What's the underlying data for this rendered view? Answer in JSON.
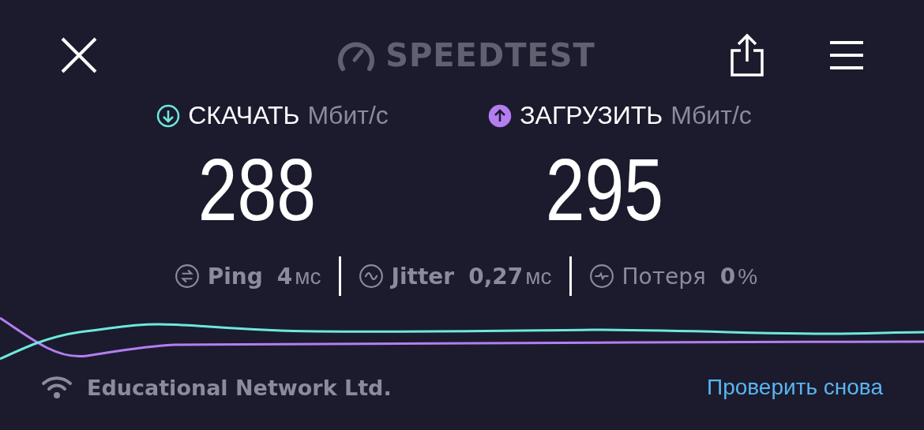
{
  "header": {
    "logo_text": "SPEEDTEST"
  },
  "metrics": [
    {
      "kind": "download",
      "color": "#6ee8dc",
      "label": "СКАЧАТЬ",
      "unit": "Мбит/с",
      "value": "288"
    },
    {
      "kind": "upload",
      "color": "#b47ef0",
      "label": "ЗАГРУЗИТЬ",
      "unit": "Мбит/с",
      "value": "295"
    }
  ],
  "stats": [
    {
      "kind": "ping",
      "label": "Ping",
      "value": "4",
      "unit": "мс"
    },
    {
      "kind": "jitter",
      "label": "Jitter",
      "value": "0,27",
      "unit": "мс"
    },
    {
      "kind": "loss",
      "label": "Потеря",
      "value": "0",
      "unit": "%"
    }
  ],
  "footer": {
    "network": "Educational Network Ltd.",
    "retest": "Проверить снова"
  }
}
